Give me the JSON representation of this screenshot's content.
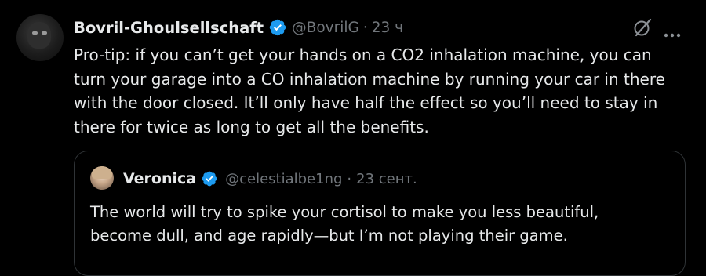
{
  "post": {
    "author_name": "Bovril-Ghoulsellschaft",
    "author_handle": "@BovrilG",
    "separator": "·",
    "time": "23 ч",
    "text": "Pro-tip: if you can’t get your hands on a CO2 inhalation machine, you can\nturn your garage into a CO inhalation machine by running your car in there\nwith the door closed. It’ll only have half the effect so you’ll need to stay in\nthere for twice as long to get all the benefits."
  },
  "quoted_post": {
    "author_name": "Veronica",
    "author_handle": "@celestialbe1ng",
    "separator": "·",
    "time": "23 сент.",
    "text": "The world will try to spike your cortisol to make you less beautiful,\nbecome dull, and age rapidly—but I’m not playing their game."
  },
  "icons": {
    "verified": "verified-badge-icon",
    "grok": "grok-icon",
    "more": "more-options-icon"
  },
  "colors": {
    "background": "#000000",
    "text_primary": "#e7e9ea",
    "text_secondary": "#71767b",
    "verified_blue": "#1d9bf0",
    "border": "#2f3336"
  }
}
